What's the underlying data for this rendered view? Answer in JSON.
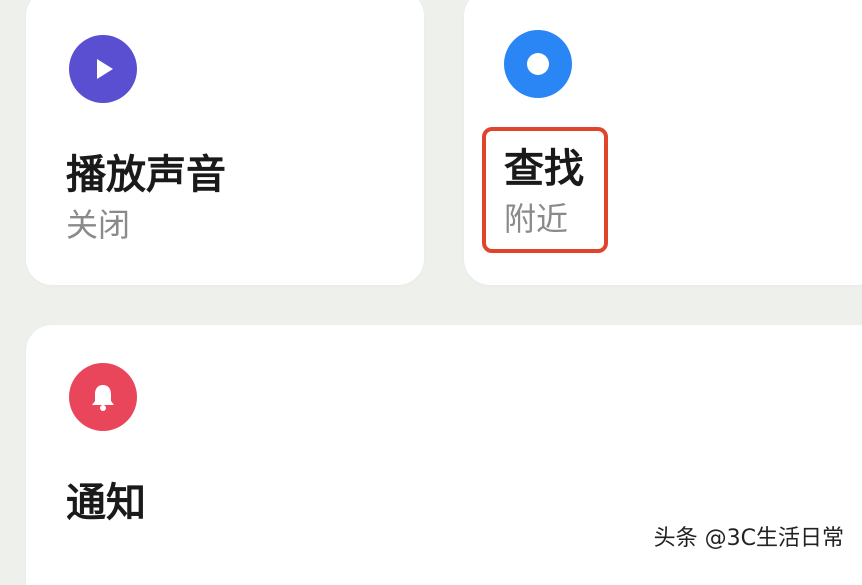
{
  "tiles": {
    "play_sound": {
      "title": "播放声音",
      "status": "关闭",
      "icon": "play-icon",
      "color": "#5a4ed1"
    },
    "find": {
      "title": "查找",
      "status": "附近",
      "icon": "locate-dot-icon",
      "color": "#2b86f5"
    },
    "notify": {
      "title": "通知",
      "icon": "bell-icon",
      "color": "#e9465c"
    }
  },
  "highlight_color": "#e0452c",
  "watermark": "头条 @3C生活日常"
}
